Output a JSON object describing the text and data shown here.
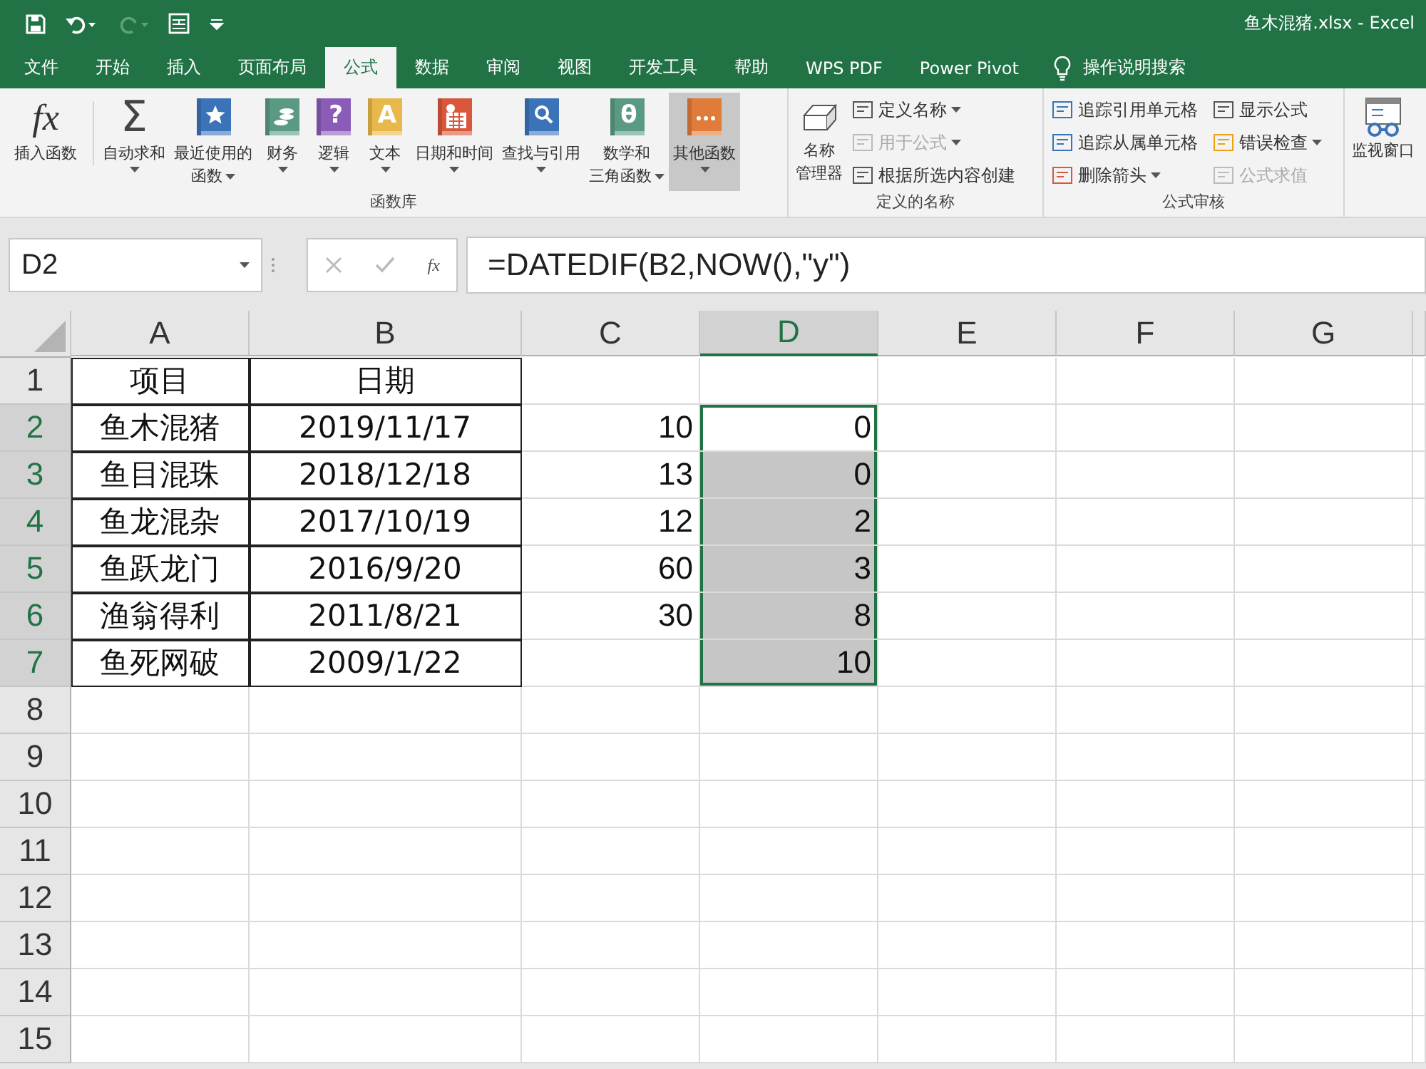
{
  "window": {
    "title": "鱼木混猪.xlsx  -  Excel"
  },
  "tabs": [
    {
      "label": "文件",
      "selected": false
    },
    {
      "label": "开始",
      "selected": false
    },
    {
      "label": "插入",
      "selected": false
    },
    {
      "label": "页面布局",
      "selected": false
    },
    {
      "label": "公式",
      "selected": true
    },
    {
      "label": "数据",
      "selected": false
    },
    {
      "label": "审阅",
      "selected": false
    },
    {
      "label": "视图",
      "selected": false
    },
    {
      "label": "开发工具",
      "selected": false
    },
    {
      "label": "帮助",
      "selected": false
    },
    {
      "label": "WPS PDF",
      "selected": false
    },
    {
      "label": "Power Pivot",
      "selected": false
    }
  ],
  "search": {
    "label": "操作说明搜索"
  },
  "function_library": {
    "label": "函数库",
    "buttons": [
      {
        "lines": [
          "插入函数"
        ],
        "glyph": "fx",
        "dropdown": false,
        "selected": false
      },
      {
        "lines": [
          "自动求和"
        ],
        "glyph": "Σ",
        "dropdown": true,
        "selected": false
      },
      {
        "lines": [
          "最近使用的",
          "函数"
        ],
        "dropdown": true,
        "selected": false
      },
      {
        "lines": [
          "财务"
        ],
        "dropdown": true,
        "selected": false
      },
      {
        "lines": [
          "逻辑"
        ],
        "glyph": "?",
        "dropdown": true,
        "selected": false
      },
      {
        "lines": [
          "文本"
        ],
        "glyph": "A",
        "dropdown": true,
        "selected": false
      },
      {
        "lines": [
          "日期和时间"
        ],
        "dropdown": true,
        "selected": false
      },
      {
        "lines": [
          "查找与引用"
        ],
        "dropdown": true,
        "selected": false
      },
      {
        "lines": [
          "数学和",
          "三角函数"
        ],
        "glyph": "θ",
        "dropdown": true,
        "selected": false
      },
      {
        "lines": [
          "其他函数"
        ],
        "dropdown": true,
        "selected": true
      }
    ]
  },
  "defined_names": {
    "label": "定义的名称",
    "manager": {
      "lines": [
        "名称",
        "管理器"
      ]
    },
    "items": [
      {
        "label": "定义名称",
        "dropdown": true,
        "disabled": false
      },
      {
        "label": "用于公式",
        "dropdown": true,
        "disabled": true
      },
      {
        "label": "根据所选内容创建",
        "dropdown": false,
        "disabled": false
      }
    ]
  },
  "formula_auditing": {
    "label": "公式审核",
    "items": [
      {
        "label": "追踪引用单元格",
        "dropdown": false,
        "disabled": false
      },
      {
        "label": "显示公式",
        "dropdown": false,
        "disabled": false
      },
      {
        "label": "追踪从属单元格",
        "dropdown": false,
        "disabled": false
      },
      {
        "label": "错误检查",
        "dropdown": true,
        "disabled": false
      },
      {
        "label": "删除箭头",
        "dropdown": true,
        "disabled": false
      },
      {
        "label": "公式求值",
        "dropdown": false,
        "disabled": true
      }
    ]
  },
  "watch_window": {
    "label": "监视窗口"
  },
  "formula_bar": {
    "name_box": "D2",
    "fx": "fx",
    "formula": "=DATEDIF(B2,NOW(),\"y\")"
  },
  "sheet": {
    "columns": [
      {
        "label": "A",
        "selected": false
      },
      {
        "label": "B",
        "selected": false
      },
      {
        "label": "C",
        "selected": false
      },
      {
        "label": "D",
        "selected": true
      },
      {
        "label": "E",
        "selected": false
      },
      {
        "label": "F",
        "selected": false
      },
      {
        "label": "G",
        "selected": false
      }
    ],
    "rows": [
      {
        "label": "1",
        "cells": [
          {
            "text": "项目",
            "boxed": true,
            "selected": false
          },
          {
            "text": "日期",
            "boxed": true,
            "selected": false
          },
          {
            "boxed": false,
            "selected": false
          },
          {
            "boxed": false,
            "selected": false
          }
        ]
      },
      {
        "label": "2",
        "cells": [
          {
            "text": "鱼木混猪",
            "boxed": true,
            "selected": false
          },
          {
            "text": "2019/11/17",
            "boxed": true,
            "selected": false
          },
          {
            "text": "10",
            "boxed": false,
            "selected": false
          },
          {
            "text": "0",
            "boxed": false,
            "selected": true
          }
        ]
      },
      {
        "label": "3",
        "cells": [
          {
            "text": "鱼目混珠",
            "boxed": true,
            "selected": false
          },
          {
            "text": "2018/12/18",
            "boxed": true,
            "selected": false
          },
          {
            "text": "13",
            "boxed": false,
            "selected": false
          },
          {
            "text": "0",
            "boxed": false,
            "selected": true
          }
        ]
      },
      {
        "label": "4",
        "cells": [
          {
            "text": "鱼龙混杂",
            "boxed": true,
            "selected": false
          },
          {
            "text": "2017/10/19",
            "boxed": true,
            "selected": false
          },
          {
            "text": "12",
            "boxed": false,
            "selected": false
          },
          {
            "text": "2",
            "boxed": false,
            "selected": true
          }
        ]
      },
      {
        "label": "5",
        "cells": [
          {
            "text": "鱼跃龙门",
            "boxed": true,
            "selected": false
          },
          {
            "text": "2016/9/20",
            "boxed": true,
            "selected": false
          },
          {
            "text": "60",
            "boxed": false,
            "selected": false
          },
          {
            "text": "3",
            "boxed": false,
            "selected": true
          }
        ]
      },
      {
        "label": "6",
        "cells": [
          {
            "text": "渔翁得利",
            "boxed": true,
            "selected": false
          },
          {
            "text": "2011/8/21",
            "boxed": true,
            "selected": false
          },
          {
            "text": "30",
            "boxed": false,
            "selected": false
          },
          {
            "text": "8",
            "boxed": false,
            "selected": true
          }
        ]
      },
      {
        "label": "7",
        "cells": [
          {
            "text": "鱼死网破",
            "boxed": true,
            "selected": false
          },
          {
            "text": "2009/1/22",
            "boxed": true,
            "selected": false
          },
          {
            "boxed": false,
            "selected": false
          },
          {
            "text": "10",
            "boxed": false,
            "selected": true
          }
        ]
      },
      {
        "label": "8",
        "cells": []
      },
      {
        "label": "9",
        "cells": []
      },
      {
        "label": "10",
        "cells": []
      },
      {
        "label": "11",
        "cells": []
      },
      {
        "label": "12",
        "cells": []
      },
      {
        "label": "13",
        "cells": []
      },
      {
        "label": "14",
        "cells": []
      },
      {
        "label": "15",
        "cells": []
      }
    ]
  }
}
